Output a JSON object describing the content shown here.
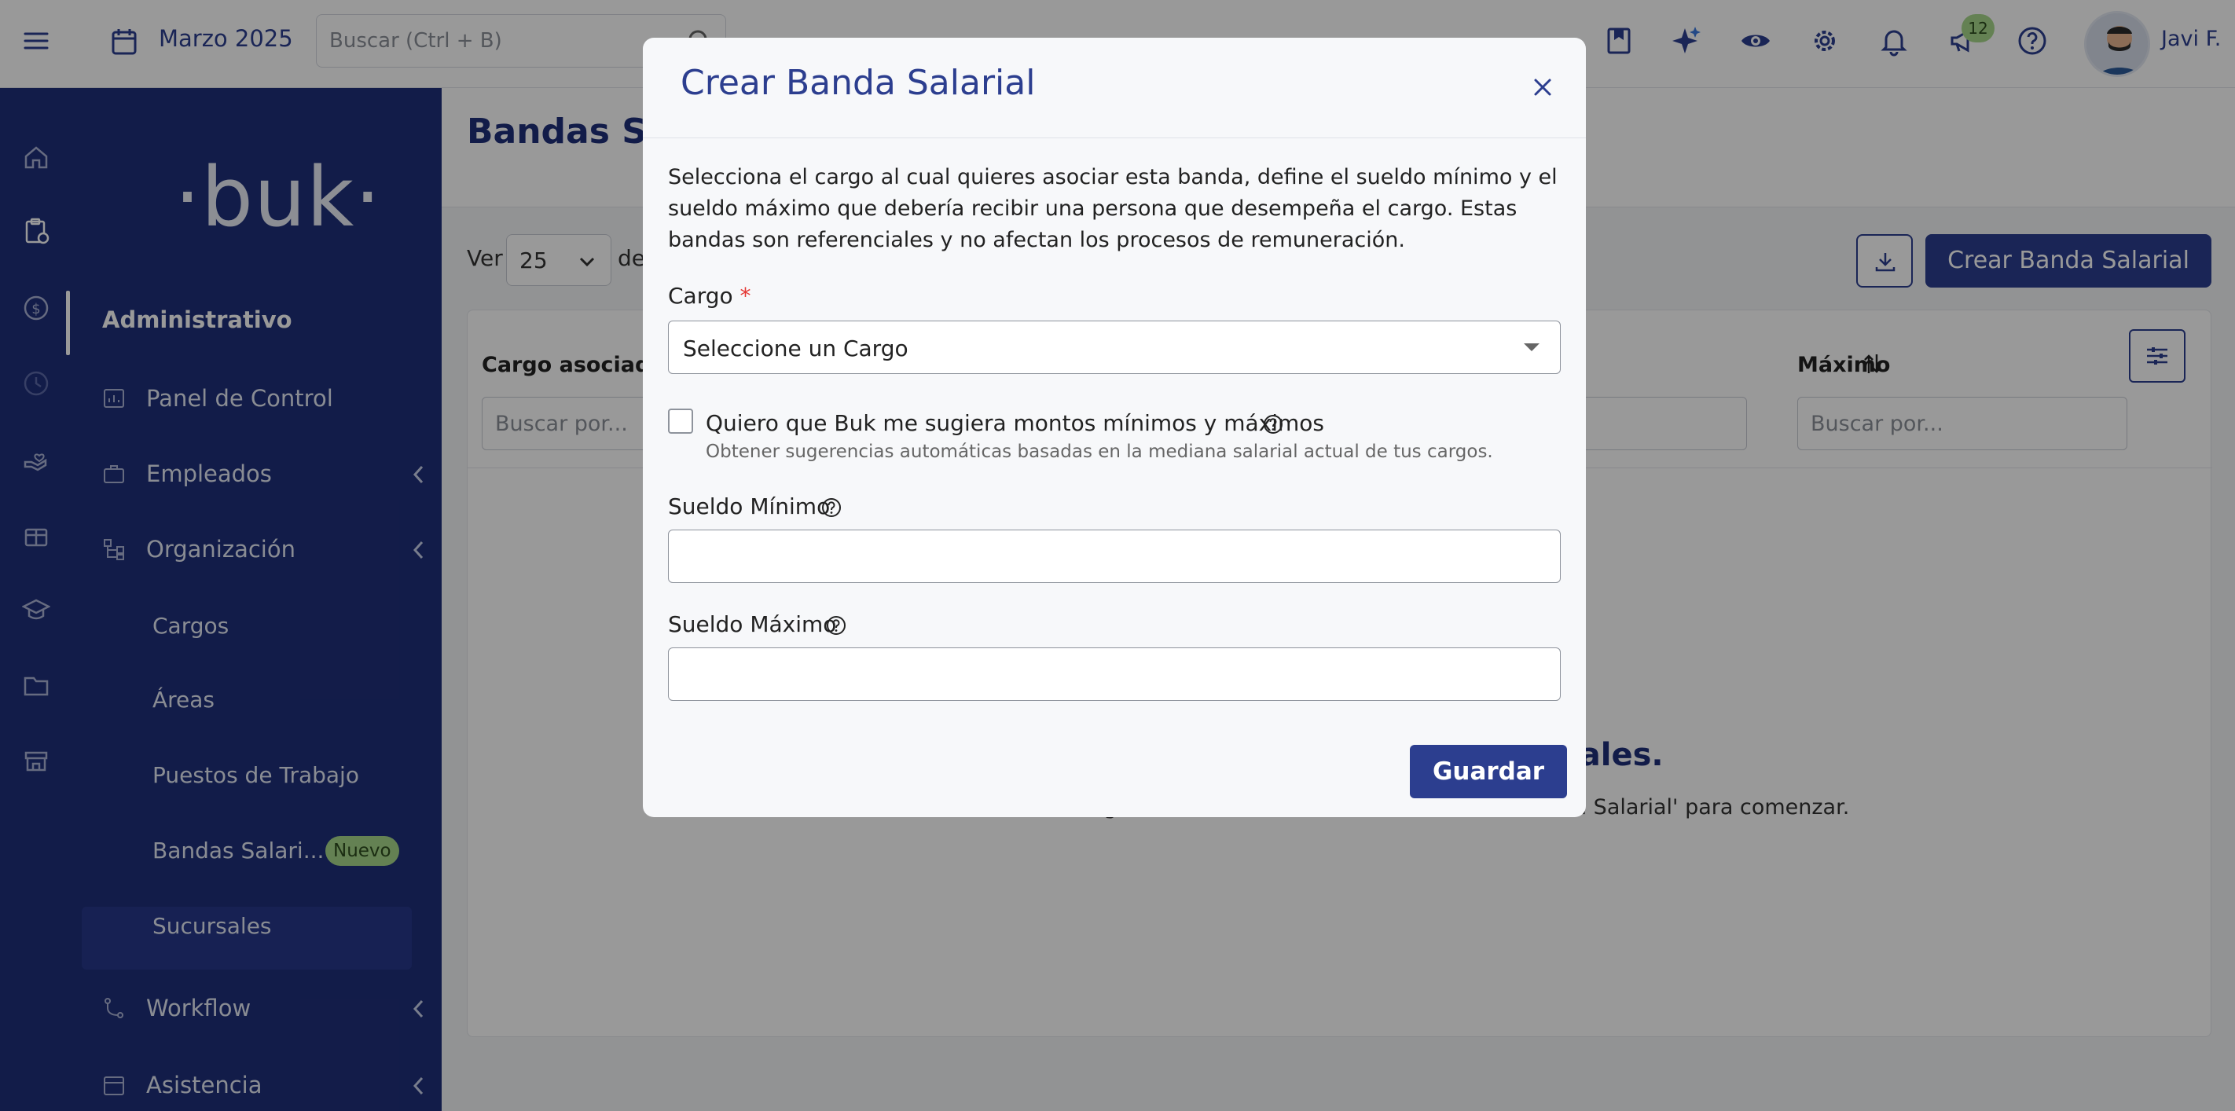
{
  "topbar": {
    "period": "Marzo 2025",
    "search_placeholder": "Buscar (Ctrl + B)",
    "notification_count": "12",
    "user_name": "Javi F."
  },
  "sidebar": {
    "logo": "·buk·",
    "section_title": "Administrativo",
    "items": [
      {
        "label": "Panel de Control",
        "icon": "dashboard-icon"
      },
      {
        "label": "Empleados",
        "icon": "briefcase-icon"
      },
      {
        "label": "Organización",
        "icon": "org-chart-icon"
      },
      {
        "label": "Workflow",
        "icon": "workflow-icon"
      },
      {
        "label": "Asistencia",
        "icon": "calendar-icon"
      }
    ],
    "subitems": [
      {
        "label": "Cargos"
      },
      {
        "label": "Áreas"
      },
      {
        "label": "Puestos de Trabajo"
      },
      {
        "label": "Bandas Salari..."
      },
      {
        "label": "Sucursales"
      }
    ],
    "new_badge": "Nuevo"
  },
  "page": {
    "title": "Bandas Sal",
    "ver_label": "Ver",
    "ver_value": "25",
    "de_label": "de",
    "create_button": "Crear Banda Salarial",
    "columns": {
      "cargo": "Cargo asociado",
      "maximo": "Máximo"
    },
    "filter_placeholder": "Buscar por...",
    "empty_title": "¡Hola! Aún no hay bandas salariales.",
    "empty_subtitle": "Todavía no has creado ninguna banda salarial. Haz clic en 'Crear Banda Salarial' para comenzar."
  },
  "modal": {
    "title": "Crear Banda Salarial",
    "description": "Selecciona el cargo al cual quieres asociar esta banda, define el sueldo mínimo y el sueldo máximo que debería recibir una persona que desempeña el cargo. Estas bandas son referenciales y no afectan los procesos de remuneración.",
    "cargo_label": "Cargo",
    "required_mark": "*",
    "cargo_placeholder": "Seleccione un Cargo",
    "suggest_label": "Quiero que Buk me sugiera montos mínimos y máximos",
    "suggest_sub": "Obtener sugerencias automáticas basadas en la mediana salarial actual de tus cargos.",
    "min_label": "Sueldo Mínimo",
    "min_value": "",
    "max_label": "Sueldo Máximo",
    "max_value": "",
    "save_button": "Guardar"
  },
  "colors": {
    "primary": "#2c3e8f",
    "sidebar": "#1f2f7a",
    "badge": "#a7d88b",
    "required": "#e53935"
  }
}
